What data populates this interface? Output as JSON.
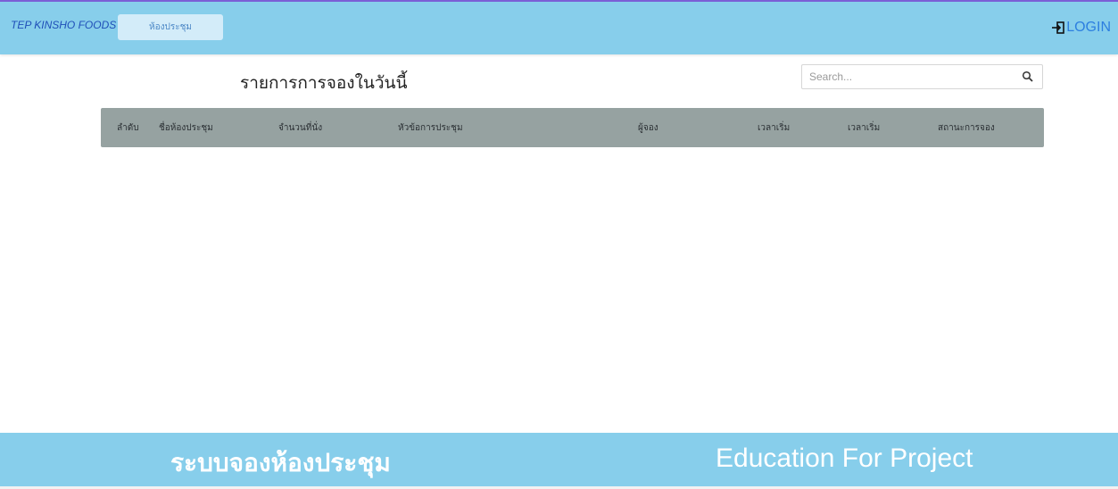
{
  "header": {
    "brand": "TEP KINSHO FOODS",
    "nav_item": "ห้องประชุม",
    "login_label": "LOGIN",
    "login_icon": "login-icon"
  },
  "main": {
    "title": "รายการการจองในวันนี้",
    "search": {
      "placeholder": "Search...",
      "value": "",
      "icon": "search-icon"
    },
    "table": {
      "columns": [
        "ลำดับ",
        "ชื่อห้องประชุม",
        "จำนวนที่นั่ง",
        "หัวข้อการประชุม",
        "ผู้จอง",
        "เวลาเริ่ม",
        "เวลาเริ่ม",
        "สถานะการจอง"
      ],
      "rows": []
    }
  },
  "footer": {
    "left_text": "ระบบจองห้องประชุม",
    "right_text": "Education For Project"
  },
  "colors": {
    "header_bg": "#87ceeb",
    "table_header_bg": "#96a2a1",
    "link": "#2d7fe0"
  }
}
